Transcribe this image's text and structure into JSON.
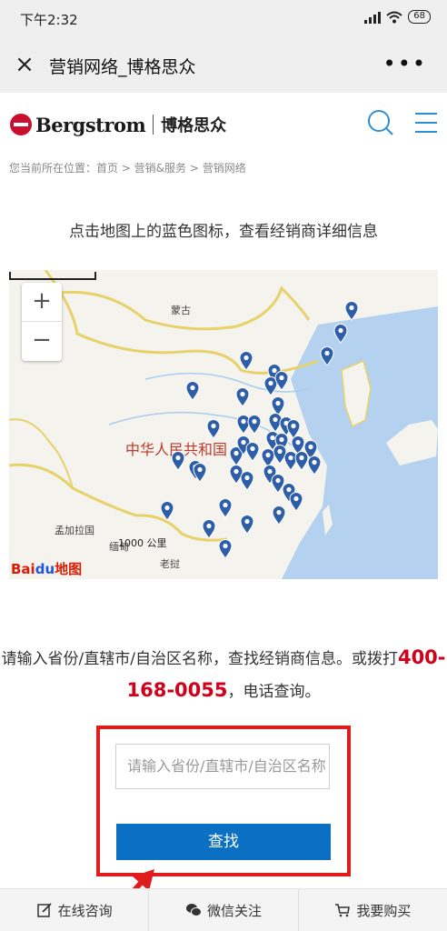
{
  "status_bar": {
    "time": "下午2:32",
    "battery": "68"
  },
  "navbar": {
    "close_icon": "close-icon",
    "title": "营销网络_博格思众",
    "more_icon": "more-icon"
  },
  "header": {
    "brand_en": "Bergstrom",
    "brand_cn": "博格思众",
    "accent_color": "#2f8fd6",
    "brand_color": "#c8102e"
  },
  "breadcrumb": "您当前所在位置：首页 > 营销&服务 > 营销网络",
  "map_hint": "点击地图上的蓝色图标，查看经销商详细信息",
  "map": {
    "zoom_in": "+",
    "zoom_out": "−",
    "labels": {
      "mongolia": "蒙古",
      "china": "中华人民共和国",
      "bangladesh": "孟加拉国",
      "laos": "老挝",
      "myanmar": "缅甸"
    },
    "scale": "1000 公里",
    "provider": "地图",
    "pin_color": "#2f5ea8"
  },
  "desc": {
    "before": "请输入省份/直辖市/自治区名称，查找经销商信息。或拨打",
    "phone": "400-168-0055",
    "after": "，电话查询。"
  },
  "search": {
    "placeholder": "请输入省份/直辖市/自治区名称",
    "button": "查找",
    "highlight_color": "#e01c1c"
  },
  "bottom_bar": {
    "consult": "在线咨询",
    "wechat": "微信关注",
    "buy": "我要购买"
  }
}
